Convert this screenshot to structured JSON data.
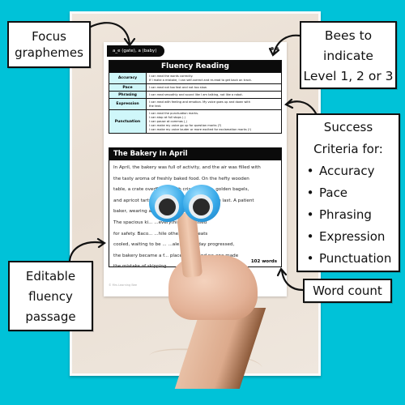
{
  "callouts": {
    "focus": {
      "lines": [
        "Focus",
        "graphemes"
      ]
    },
    "bees": {
      "lines": [
        "Bees to",
        "indicate",
        "Level 1, 2 or 3"
      ]
    },
    "success": {
      "lines": [
        "Success",
        "Criteria for:"
      ],
      "items": [
        "Accuracy",
        "Pace",
        "Phrasing",
        "Expression",
        "Punctuation"
      ],
      "bullet": "•"
    },
    "editable": {
      "lines": [
        "Editable",
        "fluency",
        "passage"
      ]
    },
    "word_count": {
      "label": "Word count"
    }
  },
  "worksheet": {
    "grapheme_tab": "a_e (gate), a (baby)",
    "fluency_title": "Fluency Reading",
    "criteria": [
      {
        "label": "Accuracy",
        "lines": [
          "I can read the words correctly.",
          "If I make a mistake, I can self-correct and re-read to get back on track."
        ]
      },
      {
        "label": "Pace",
        "lines": [
          "I can read not too fast and not too slow."
        ]
      },
      {
        "label": "Phrasing",
        "lines": [
          "I can read smoothly and sound like I am talking, not like a robot."
        ]
      },
      {
        "label": "Expression",
        "lines": [
          "I can read with feeling and emotion. My voice goes up and down with",
          "the text."
        ]
      },
      {
        "label": "Punctuation",
        "lines": [
          "I can read the punctuation marks.",
          "I can stop at full stops (.)",
          "I can pause at commas (,)",
          "I can make my voice go up for question marks (?)",
          "I can make my voice louder or more excited for exclamation marks (!)"
        ]
      }
    ],
    "passage_title": "The Bakery In April",
    "passage_lines": [
      "In April, the bakery was full of activity, and the air was filled with",
      "the tasty aroma of freshly baked food. On the hefty wooden",
      "table, a crate overflowed with crispy wafers, golden bagels,",
      "and apricot tarts, each more tempting than the last. A patient",
      "baker, wearing a               ...y arranged the treats.",
      "The spacious ki...              ...everything organised",
      "for safety. Baco...              ...hile other tasty treats",
      "cooled, waiting to be ...         ...ale. As the day progressed,",
      "the bakery became a f...     place to be, and no-one made",
      "the mistake of skipping"
    ],
    "word_count": "102 words",
    "copyright": "© Mrs Learning Bee"
  },
  "colors": {
    "background": "#00c2d8",
    "label_cell": "#cff7fa",
    "header": "#0b0b0b"
  }
}
